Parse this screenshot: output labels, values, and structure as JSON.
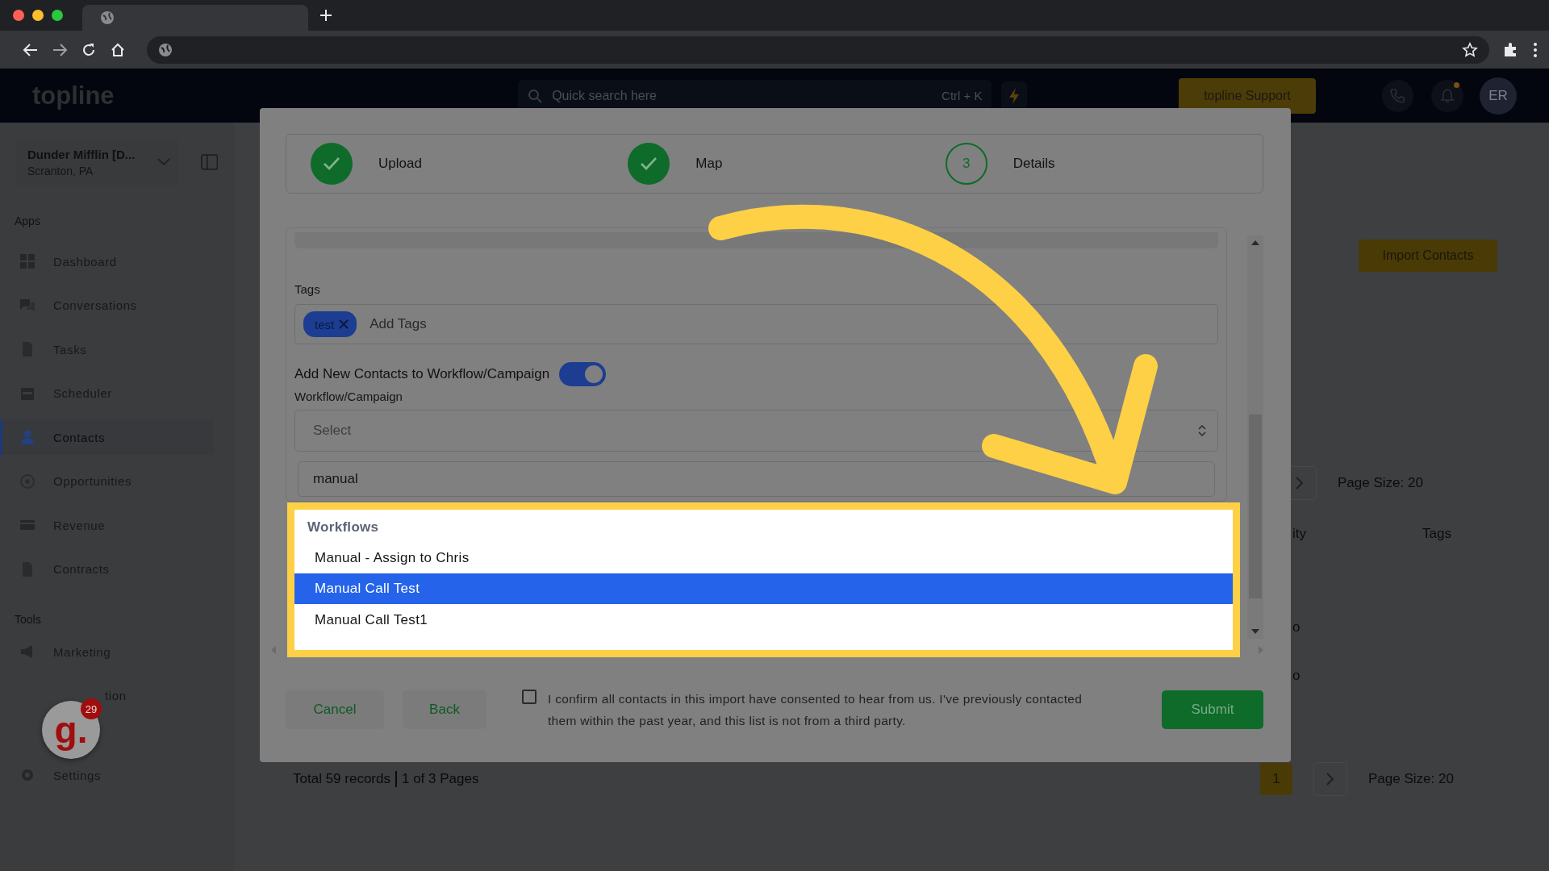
{
  "header": {
    "logo": "topline",
    "search": {
      "placeholder": "Quick search here",
      "shortcut": "Ctrl + K"
    },
    "support_button": "topline Support",
    "avatar": "ER"
  },
  "sidebar": {
    "account": {
      "name": "Dunder Mifflin [D...",
      "location": "Scranton, PA"
    },
    "sections": [
      {
        "title": "Apps",
        "items": [
          {
            "label": "Dashboard",
            "selected": false
          },
          {
            "label": "Conversations",
            "selected": false
          },
          {
            "label": "Tasks",
            "selected": false
          },
          {
            "label": "Scheduler",
            "selected": false
          },
          {
            "label": "Contacts",
            "selected": true
          },
          {
            "label": "Opportunities",
            "selected": false
          },
          {
            "label": "Revenue",
            "selected": false
          },
          {
            "label": "Contracts",
            "selected": false
          }
        ]
      },
      {
        "title": "Tools",
        "items": [
          {
            "label": "Marketing",
            "selected": false
          },
          {
            "label": "tion",
            "selected": false
          }
        ]
      }
    ],
    "footer_item": "Settings"
  },
  "launcher": {
    "text": "g.",
    "count": "29"
  },
  "main": {
    "import_button": "Import Contacts",
    "page_size_top": "Page Size: 20",
    "columns": [
      "ity",
      "Tags"
    ],
    "cells": [
      "o",
      "o"
    ],
    "footer": {
      "summary": "Total 59 records",
      "pages": "1 of 3 Pages",
      "current_page": "1",
      "page_size": "Page Size: 20"
    }
  },
  "modal": {
    "steps": [
      {
        "label": "Upload",
        "done": true
      },
      {
        "label": "Map",
        "done": true
      },
      {
        "label": "Details",
        "number": "3",
        "done": false
      }
    ],
    "tags": {
      "label": "Tags",
      "chips": [
        "test"
      ],
      "placeholder": "Add Tags"
    },
    "toggle": {
      "label": "Add New Contacts to Workflow/Campaign",
      "on": true
    },
    "workflow": {
      "label": "Workflow/Campaign",
      "placeholder": "Select"
    },
    "search": {
      "value": "manual"
    },
    "dropdown": {
      "group": "Workflows",
      "options": [
        {
          "label": "Manual - Assign to Chris",
          "selected": false
        },
        {
          "label": "Manual Call Test",
          "selected": true
        },
        {
          "label": "Manual Call Test1",
          "selected": false
        }
      ]
    },
    "consent": {
      "checked": false,
      "text": "I confirm all contacts in this import have consented to hear from us. I've previously contacted them within the past year, and this list is not from a third party."
    },
    "buttons": {
      "cancel": "Cancel",
      "back": "Back",
      "submit": "Submit"
    }
  }
}
